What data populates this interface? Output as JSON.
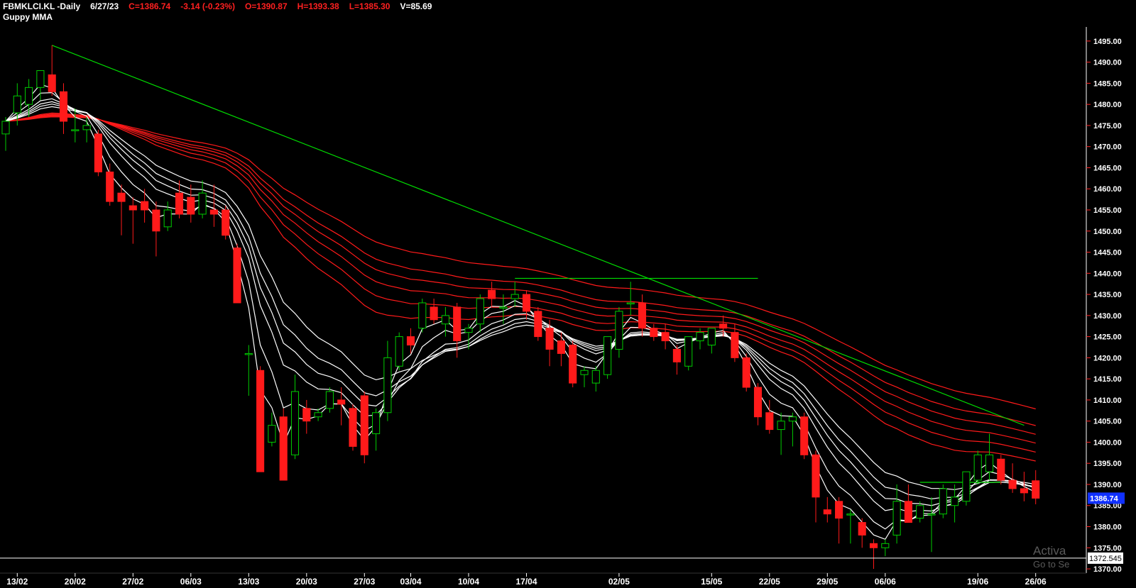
{
  "header": {
    "symbol": "FBMKLCI.KL -Daily",
    "date": "6/27/23",
    "close": "C=1386.74",
    "change": "-3.14 (-0.23%)",
    "open": "O=1390.87",
    "high": "H=1393.38",
    "low": "L=1385.30",
    "volume": "V=85.69"
  },
  "indicator_label": "Guppy MMA",
  "watermark": {
    "line1": "Activa",
    "line2": "Go to Se"
  },
  "colors": {
    "background": "#000000",
    "up_candle": "#00cc00",
    "down_candle": "#ff1a1a",
    "short_mma": "#ffffff",
    "long_mma": "#ff1a1a",
    "trendline": "#00dd00",
    "last_price_box": "#1030ff"
  },
  "chart_data": {
    "type": "candlestick",
    "ylim": [
      1369,
      1498
    ],
    "y_ticks": [
      "1370.00",
      "1375.00",
      "1380.00",
      "1385.00",
      "1390.00",
      "1395.00",
      "1400.00",
      "1405.00",
      "1410.00",
      "1415.00",
      "1420.00",
      "1425.00",
      "1430.00",
      "1435.00",
      "1440.00",
      "1445.00",
      "1450.00",
      "1455.00",
      "1460.00",
      "1465.00",
      "1470.00",
      "1475.00",
      "1480.00",
      "1485.00",
      "1490.00",
      "1495.00"
    ],
    "x_ticks": [
      {
        "label": "13/02",
        "index": 1
      },
      {
        "label": "20/02",
        "index": 6
      },
      {
        "label": "27/02",
        "index": 11
      },
      {
        "label": "06/03",
        "index": 16
      },
      {
        "label": "13/03",
        "index": 21
      },
      {
        "label": "20/03",
        "index": 26
      },
      {
        "label": "27/03",
        "index": 31
      },
      {
        "label": "03/04",
        "index": 35
      },
      {
        "label": "10/04",
        "index": 40
      },
      {
        "label": "17/04",
        "index": 45
      },
      {
        "label": "02/05",
        "index": 53
      },
      {
        "label": "15/05",
        "index": 61
      },
      {
        "label": "22/05",
        "index": 66
      },
      {
        "label": "29/05",
        "index": 71
      },
      {
        "label": "06/06",
        "index": 76
      },
      {
        "label": "19/06",
        "index": 84
      },
      {
        "label": "26/06",
        "index": 89
      }
    ],
    "last_price_label": "1386.74",
    "horizontal_line_label": "1372.545",
    "horizontal_line_value": 1372.545,
    "candles": [
      [
        1473,
        1477,
        1469,
        1476
      ],
      [
        1478,
        1485,
        1475,
        1482
      ],
      [
        1480,
        1486,
        1477,
        1484
      ],
      [
        1484,
        1488,
        1481,
        1488
      ],
      [
        1487,
        1494,
        1482,
        1483
      ],
      [
        1483,
        1485,
        1473,
        1476
      ],
      [
        1474,
        1479,
        1471,
        1474
      ],
      [
        1474,
        1477,
        1471,
        1475
      ],
      [
        1473,
        1474,
        1463,
        1464
      ],
      [
        1464,
        1466,
        1456,
        1457
      ],
      [
        1459,
        1461,
        1449,
        1457
      ],
      [
        1456,
        1458,
        1447,
        1455
      ],
      [
        1457,
        1460,
        1452,
        1455
      ],
      [
        1455,
        1457,
        1444,
        1450
      ],
      [
        1451,
        1457,
        1450,
        1455
      ],
      [
        1459,
        1462,
        1453,
        1454
      ],
      [
        1458,
        1461,
        1452,
        1454
      ],
      [
        1454,
        1462,
        1453,
        1459
      ],
      [
        1455,
        1461,
        1451,
        1454
      ],
      [
        1455,
        1456,
        1448,
        1449
      ],
      [
        1446,
        1447,
        1433,
        1433
      ],
      [
        1421,
        1423,
        1411,
        1421
      ],
      [
        1417,
        1418,
        1393,
        1393
      ],
      [
        1400,
        1407,
        1399,
        1404
      ],
      [
        1406,
        1408,
        1392,
        1391
      ],
      [
        1397,
        1416,
        1396,
        1412
      ],
      [
        1408,
        1410,
        1402,
        1405
      ],
      [
        1406,
        1408,
        1405,
        1407
      ],
      [
        1408,
        1413,
        1407,
        1412
      ],
      [
        1410,
        1413,
        1404,
        1409
      ],
      [
        1408,
        1409,
        1398,
        1399
      ],
      [
        1411,
        1412,
        1395,
        1397
      ],
      [
        1402,
        1408,
        1398,
        1407
      ],
      [
        1407,
        1424,
        1405,
        1420
      ],
      [
        1418,
        1426,
        1417,
        1425
      ],
      [
        1425,
        1427,
        1421,
        1423
      ],
      [
        1427,
        1434,
        1426,
        1433
      ],
      [
        1432,
        1434,
        1428,
        1429
      ],
      [
        1428,
        1432,
        1425,
        1430
      ],
      [
        1432,
        1433,
        1420,
        1424
      ],
      [
        1426,
        1428,
        1422,
        1427
      ],
      [
        1428,
        1435,
        1426,
        1434
      ],
      [
        1436,
        1438,
        1432,
        1434
      ],
      [
        1432,
        1435,
        1428,
        1432
      ],
      [
        1434,
        1438,
        1432,
        1435
      ],
      [
        1435,
        1436,
        1429,
        1431
      ],
      [
        1431,
        1432,
        1424,
        1425
      ],
      [
        1427,
        1429,
        1418,
        1422
      ],
      [
        1424,
        1426,
        1418,
        1421
      ],
      [
        1423,
        1424,
        1413,
        1414
      ],
      [
        1416,
        1418,
        1413,
        1417
      ],
      [
        1414,
        1418,
        1412,
        1417
      ],
      [
        1416,
        1422,
        1415,
        1425
      ],
      [
        1422,
        1432,
        1420,
        1431
      ],
      [
        1433,
        1438,
        1430,
        1433
      ],
      [
        1433,
        1435,
        1425,
        1427
      ],
      [
        1427,
        1428,
        1424,
        1425
      ],
      [
        1426,
        1428,
        1422,
        1424
      ],
      [
        1422,
        1423,
        1416,
        1419
      ],
      [
        1418,
        1424,
        1417,
        1425
      ],
      [
        1424,
        1427,
        1422,
        1426
      ],
      [
        1423,
        1427,
        1421,
        1427
      ],
      [
        1428,
        1430,
        1425,
        1427
      ],
      [
        1426,
        1428,
        1419,
        1420
      ],
      [
        1420,
        1421,
        1412,
        1413
      ],
      [
        1413,
        1414,
        1404,
        1406
      ],
      [
        1407,
        1410,
        1402,
        1403
      ],
      [
        1403,
        1407,
        1397,
        1405
      ],
      [
        1405,
        1407,
        1399,
        1406
      ],
      [
        1406,
        1407,
        1396,
        1397
      ],
      [
        1397,
        1398,
        1381,
        1387
      ],
      [
        1384,
        1387,
        1381,
        1383
      ],
      [
        1386,
        1387,
        1376,
        1382
      ],
      [
        1383,
        1384,
        1376,
        1383
      ],
      [
        1381,
        1382,
        1375,
        1378
      ],
      [
        1376,
        1377,
        1370,
        1375
      ],
      [
        1375,
        1377,
        1373,
        1376
      ],
      [
        1378,
        1390,
        1376,
        1386
      ],
      [
        1386,
        1390,
        1381,
        1381
      ],
      [
        1382,
        1386,
        1381,
        1385
      ],
      [
        1383,
        1387,
        1374,
        1383
      ],
      [
        1383,
        1390,
        1382,
        1389
      ],
      [
        1385,
        1390,
        1381,
        1387
      ],
      [
        1386,
        1393,
        1385,
        1393
      ],
      [
        1391,
        1398,
        1390,
        1397
      ],
      [
        1393,
        1402,
        1391,
        1397
      ],
      [
        1396,
        1397,
        1390,
        1391
      ],
      [
        1391,
        1395,
        1388,
        1389
      ],
      [
        1389,
        1393,
        1386,
        1388
      ],
      [
        1390.87,
        1393.38,
        1385.3,
        1386.74
      ]
    ],
    "long_mma_periods": [
      30,
      35,
      40,
      45,
      50,
      60
    ],
    "short_mma_periods": [
      3,
      5,
      8,
      10,
      12,
      15
    ],
    "trendlines": [
      {
        "from": [
          4,
          1494
        ],
        "to": [
          88,
          1404
        ]
      },
      {
        "from": [
          44,
          1438.8
        ],
        "to": [
          65,
          1438.8
        ]
      },
      {
        "from": [
          79,
          1390.5
        ],
        "to": [
          86,
          1390.5
        ]
      }
    ]
  }
}
